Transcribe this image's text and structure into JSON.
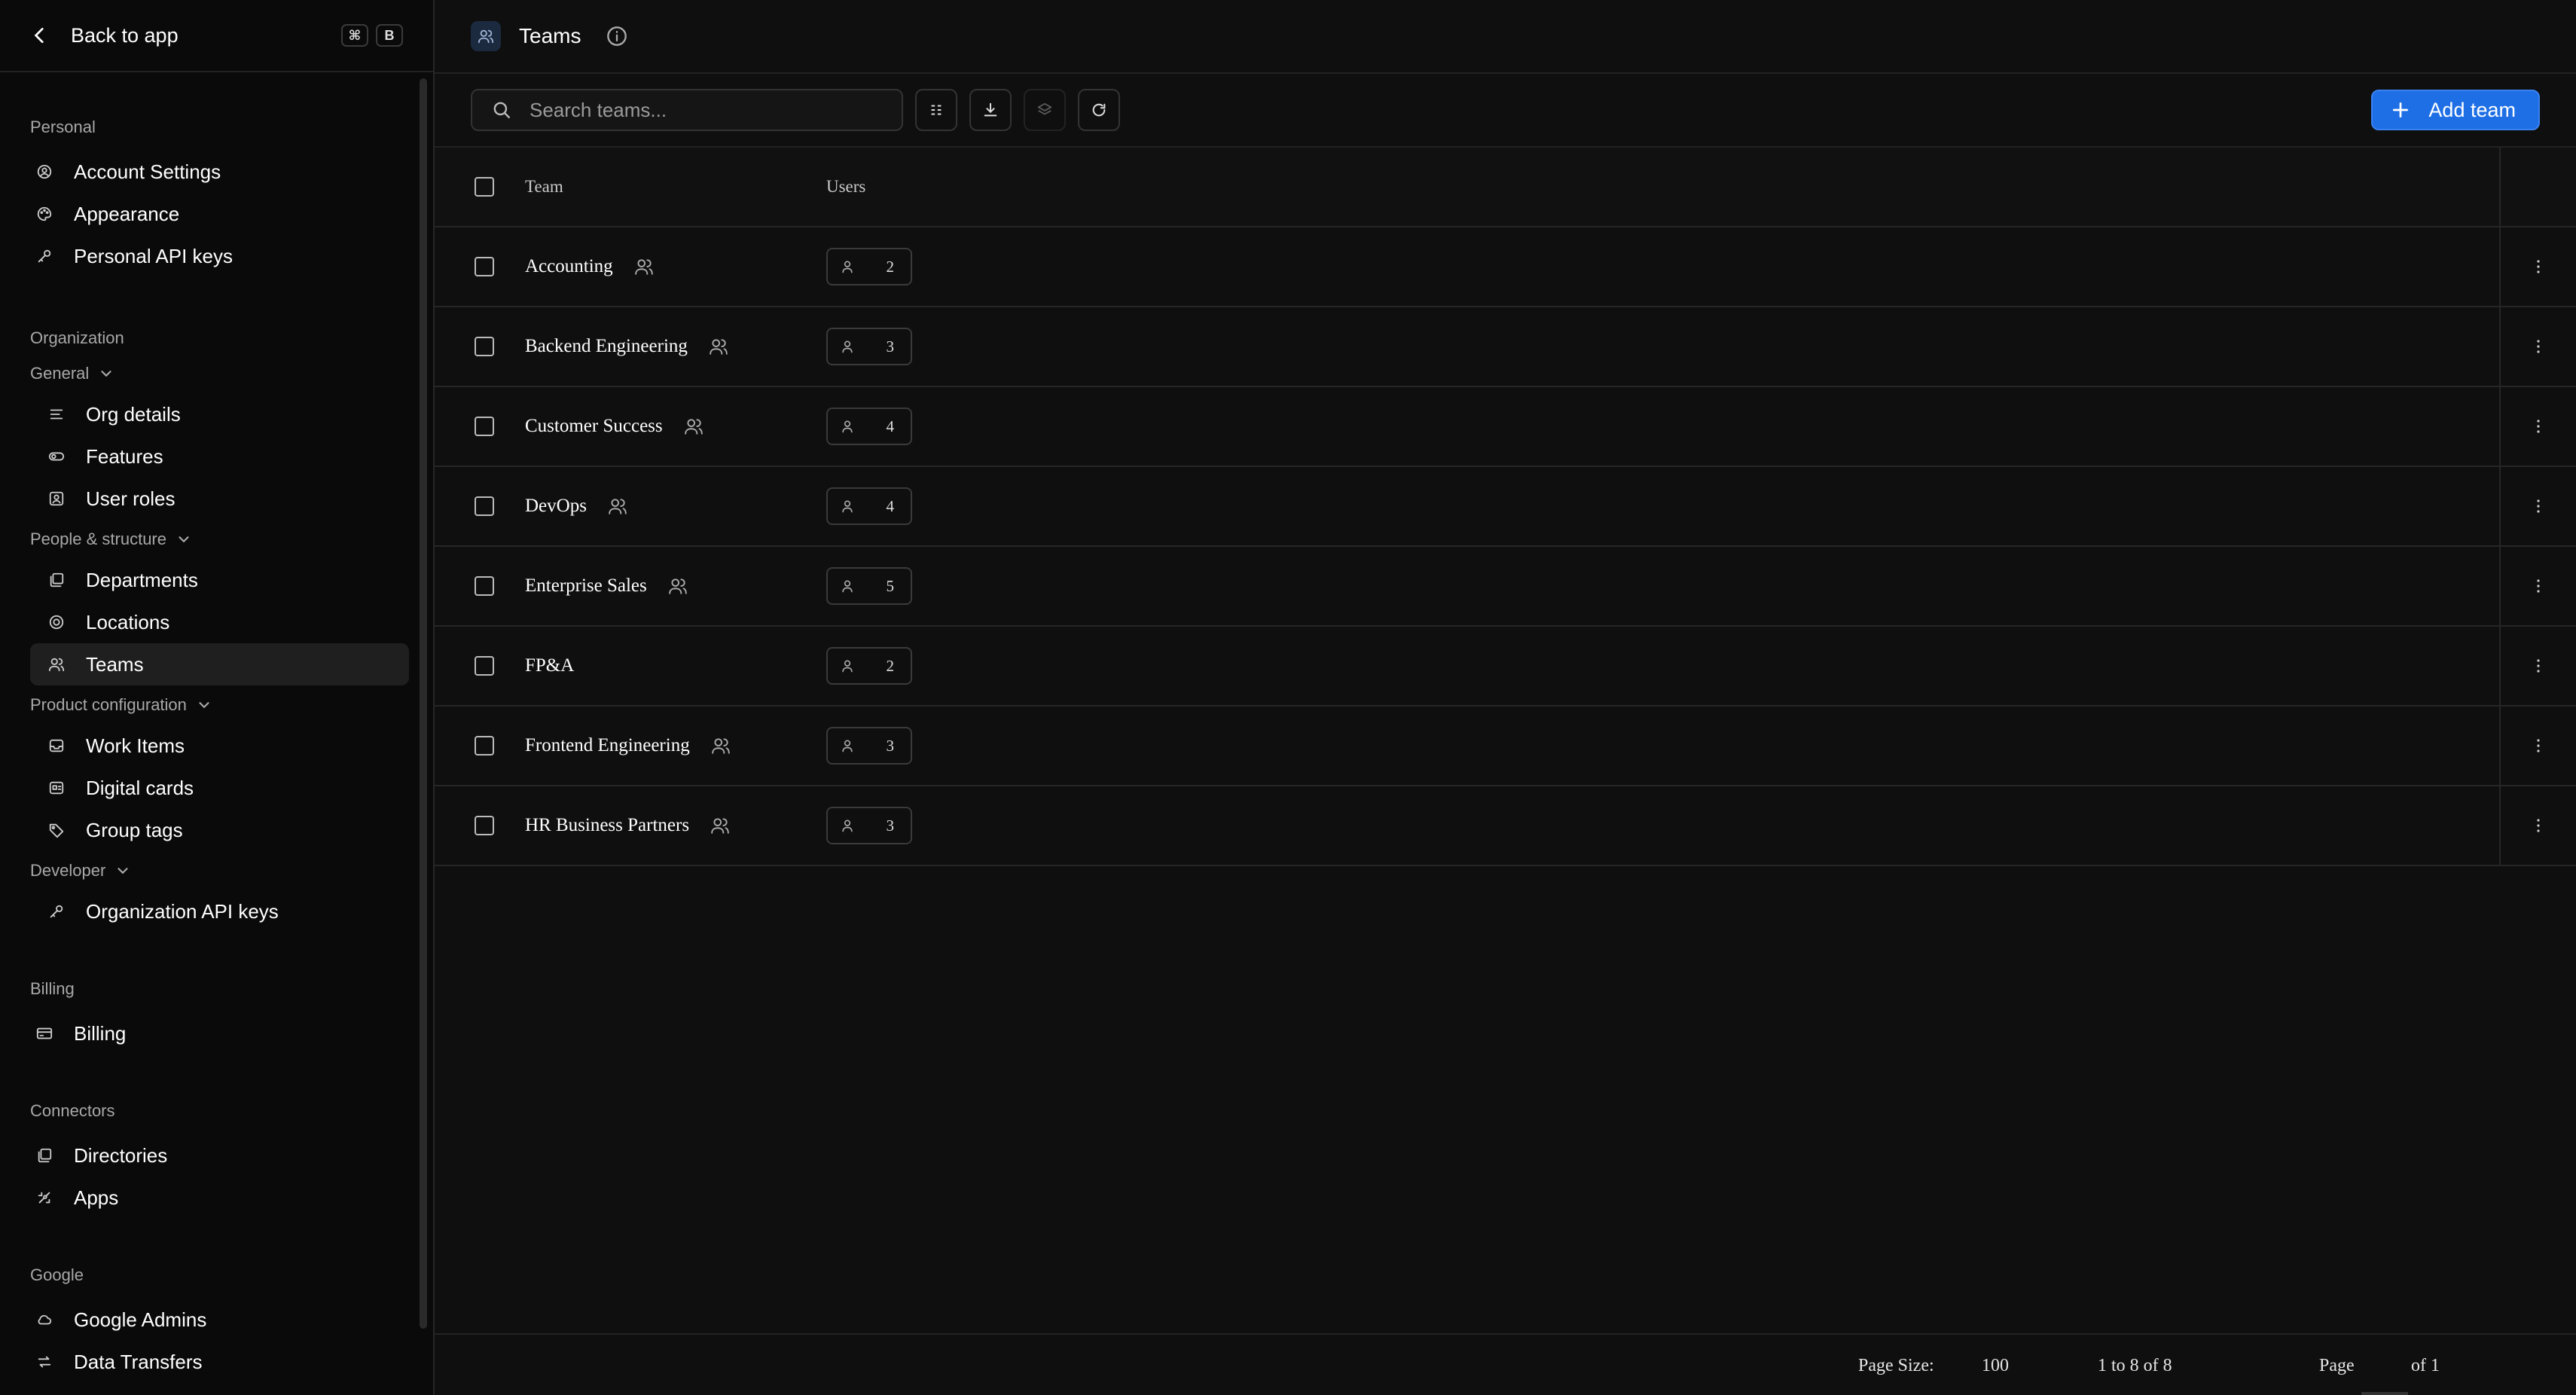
{
  "sidebar": {
    "back_label": "Back to app",
    "shortcut": [
      "⌘",
      "B"
    ],
    "sections": [
      {
        "title": "Personal",
        "items": [
          {
            "label": "Account Settings",
            "icon": "user-circle-icon"
          },
          {
            "label": "Appearance",
            "icon": "palette-icon"
          },
          {
            "label": "Personal API keys",
            "icon": "key-icon"
          }
        ]
      },
      {
        "title": "Organization",
        "groups": [
          {
            "title": "General",
            "items": [
              {
                "label": "Org details",
                "icon": "lines-icon"
              },
              {
                "label": "Features",
                "icon": "toggle-icon"
              },
              {
                "label": "User roles",
                "icon": "id-card-icon"
              }
            ]
          },
          {
            "title": "People & structure",
            "items": [
              {
                "label": "Departments",
                "icon": "layers-icon"
              },
              {
                "label": "Locations",
                "icon": "location-icon"
              },
              {
                "label": "Teams",
                "icon": "users-icon",
                "active": true
              }
            ]
          },
          {
            "title": "Product configuration",
            "items": [
              {
                "label": "Work Items",
                "icon": "inbox-icon"
              },
              {
                "label": "Digital cards",
                "icon": "card-icon"
              },
              {
                "label": "Group tags",
                "icon": "tag-icon"
              }
            ]
          },
          {
            "title": "Developer",
            "items": [
              {
                "label": "Organization API keys",
                "icon": "key-icon"
              }
            ]
          }
        ]
      },
      {
        "title": "Billing",
        "items": [
          {
            "label": "Billing",
            "icon": "credit-card-icon"
          }
        ]
      },
      {
        "title": "Connectors",
        "items": [
          {
            "label": "Directories",
            "icon": "layers-icon"
          },
          {
            "label": "Apps",
            "icon": "apps-icon"
          }
        ]
      },
      {
        "title": "Google",
        "items": [
          {
            "label": "Google Admins",
            "icon": "cloud-icon"
          },
          {
            "label": "Data Transfers",
            "icon": "transfer-icon"
          }
        ]
      }
    ]
  },
  "header": {
    "title": "Teams"
  },
  "toolbar": {
    "search_placeholder": "Search teams...",
    "add_label": "Add team"
  },
  "table": {
    "columns": [
      "Team",
      "Users"
    ],
    "rows": [
      {
        "team": "Accounting",
        "users": "2",
        "has_icon": true
      },
      {
        "team": "Backend Engineering",
        "users": "3",
        "has_icon": true
      },
      {
        "team": "Customer Success",
        "users": "4",
        "has_icon": true
      },
      {
        "team": "DevOps",
        "users": "4",
        "has_icon": true
      },
      {
        "team": "Enterprise Sales",
        "users": "5",
        "has_icon": true
      },
      {
        "team": "FP&A",
        "users": "2",
        "has_icon": false
      },
      {
        "team": "Frontend Engineering",
        "users": "3",
        "has_icon": true
      },
      {
        "team": "HR Business Partners",
        "users": "3",
        "has_icon": true
      }
    ]
  },
  "footer": {
    "page_size_label": "Page Size:",
    "page_size": "100",
    "range": "1 to 8 of 8",
    "page_label": "Page",
    "page_total": "of 1"
  },
  "colors": {
    "accent": "#1e6fe6",
    "background": "#0f0f0f",
    "sidebar": "#0a0a0a"
  }
}
